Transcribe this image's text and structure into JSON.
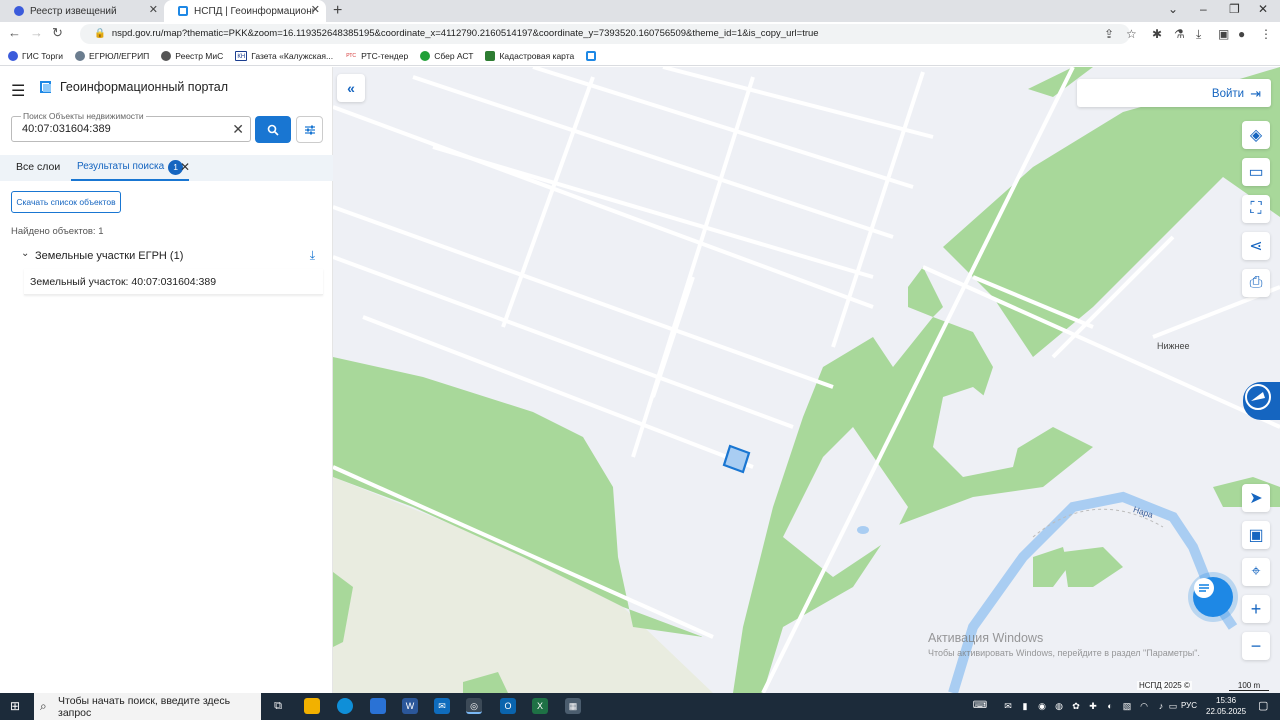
{
  "browser": {
    "tabs": [
      {
        "title": "Реестр извещений"
      },
      {
        "title": "НСПД | Геоинформационный п"
      }
    ],
    "url": "nspd.gov.ru/map?thematic=PKK&zoom=16.119352648385195&coordinate_x=4112790.2160514197&coordinate_y=7393520.160756509&theme_id=1&is_copy_url=true",
    "bookmarks": [
      "ГИС Торги",
      "ЕГРЮЛ/ЕГРИП",
      "Реестр МиС",
      "Газета «Калужская...",
      "РТС-тендер",
      "Сбер АСТ",
      "Кадастровая карта"
    ],
    "bookmark_badges": [
      "КН",
      "РТС"
    ]
  },
  "sidebar": {
    "portal_title": "Геоинформационный портал",
    "search": {
      "label": "Поиск Объекты недвижимости",
      "value": "40:07:031604:389"
    },
    "tabs": {
      "all": "Все слои",
      "results": "Результаты поиска",
      "results_count": "1"
    },
    "download_list": "Скачать список объектов",
    "found": "Найдено объектов: 1",
    "group": {
      "label": "Земельные участки ЕГРН (1)",
      "items": [
        {
          "label": "Земельный участок: 40:07:031604:389"
        }
      ]
    }
  },
  "map": {
    "login": "Войти",
    "place_label": "Нижнее",
    "river_label": "Нара",
    "credit": "НСПД 2025 ©",
    "scale": "100 m",
    "accent": "#1976d2",
    "forest_color": "#a8d89a",
    "water_color": "#a9cdf2"
  },
  "watermark": {
    "title": "Активация Windows",
    "text": "Чтобы активировать Windows, перейдите в раздел \"Параметры\"."
  },
  "taskbar": {
    "search_placeholder": "Чтобы начать поиск, введите здесь запрос",
    "lang": "РУС",
    "time": "15:36",
    "date": "22.05.2025"
  }
}
